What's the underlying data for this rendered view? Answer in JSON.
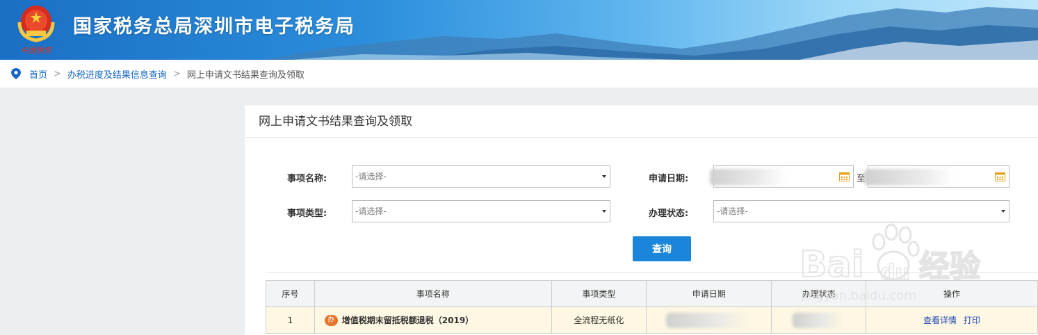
{
  "header": {
    "site_title": "国家税务总局深圳市电子税务局",
    "emblem_caption": "中国税务"
  },
  "breadcrumb": {
    "items": [
      "首页",
      "办税进度及结果信息查询"
    ],
    "separator": ">",
    "current": "网上申请文书结果查询及领取"
  },
  "panel": {
    "title": "网上申请文书结果查询及领取"
  },
  "form": {
    "item_name_label": "事项名称:",
    "item_name_value": "-请选择-",
    "item_type_label": "事项类型:",
    "item_type_value": "-请选择-",
    "apply_date_label": "申请日期:",
    "date_to_label": "至",
    "status_label": "办理状态:",
    "status_value": "-请选择-",
    "query_button": "查询"
  },
  "table": {
    "headers": [
      "序号",
      "事项名称",
      "事项类型",
      "申请日期",
      "办理状态",
      "操作"
    ],
    "rows": [
      {
        "index": "1",
        "badge": "办",
        "name": "增值税期末留抵税额退税（2019）",
        "type": "全流程无纸化",
        "actions": [
          "查看详情",
          "打印"
        ]
      }
    ]
  },
  "watermark": {
    "brand": "Bai",
    "brand_suffix": "du",
    "cn": "经验",
    "url": "jingyan.baidu.com"
  },
  "colors": {
    "banner": "#2b8ddb",
    "link": "#1668c4",
    "primary_button": "#1b85d9",
    "row_highlight": "#fdf7e3",
    "badge": "#e6742b"
  }
}
